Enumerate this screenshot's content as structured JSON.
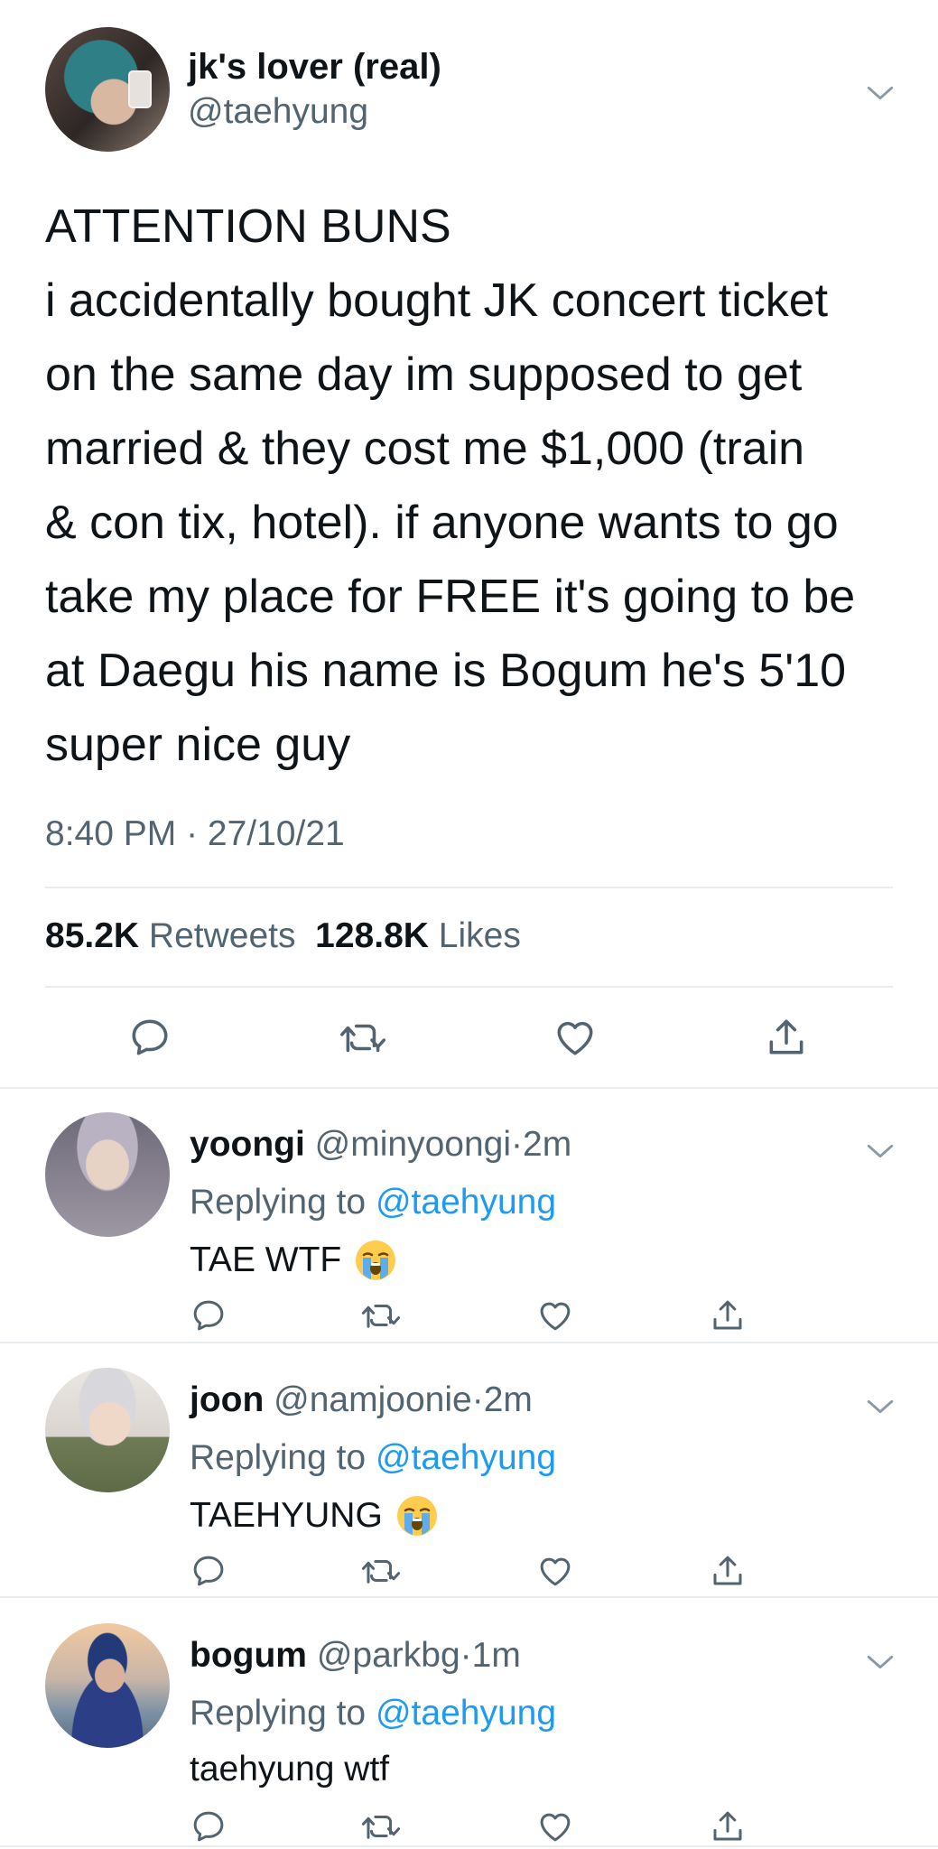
{
  "main_tweet": {
    "display_name": "jk's lover (real)",
    "handle": "@taehyung",
    "text_lines": [
      "ATTENTION BUNS",
      "i accidentally bought JK concert ticket",
      "on the same day im supposed to get",
      "married & they cost me $1,000 (train",
      "& con tix, hotel). if anyone wants to go",
      "take my place for FREE it's going to be",
      "at Daegu his name is Bogum he's 5'10",
      "super nice guy"
    ],
    "timestamp": "8:40 PM · 27/10/21",
    "retweets_count": "85.2K",
    "retweets_label": "Retweets",
    "likes_count": "128.8K",
    "likes_label": "Likes"
  },
  "replies": [
    {
      "display_name": "yoongi",
      "handle": "@minyoongi",
      "separator": "·",
      "time": "2m",
      "replying_prefix": "Replying to",
      "replying_to": "@taehyung",
      "text": "TAE WTF",
      "emoji": "loudly-crying-face"
    },
    {
      "display_name": "joon",
      "handle": "@namjoonie",
      "separator": "·",
      "time": "2m",
      "replying_prefix": "Replying to",
      "replying_to": "@taehyung",
      "text": "TAEHYUNG",
      "emoji": "loudly-crying-face"
    },
    {
      "display_name": "bogum",
      "handle": "@parkbg",
      "separator": "·",
      "time": "1m",
      "replying_prefix": "Replying to",
      "replying_to": "@taehyung",
      "text": "taehyung wtf"
    }
  ],
  "icons": {
    "reply": "reply-icon",
    "retweet": "retweet-icon",
    "like": "heart-icon",
    "share": "share-icon",
    "more": "chevron-down-icon"
  },
  "colors": {
    "text": "#0f1419",
    "secondary": "#536471",
    "link": "#1d9bf0",
    "divider": "#e6ecf0"
  }
}
